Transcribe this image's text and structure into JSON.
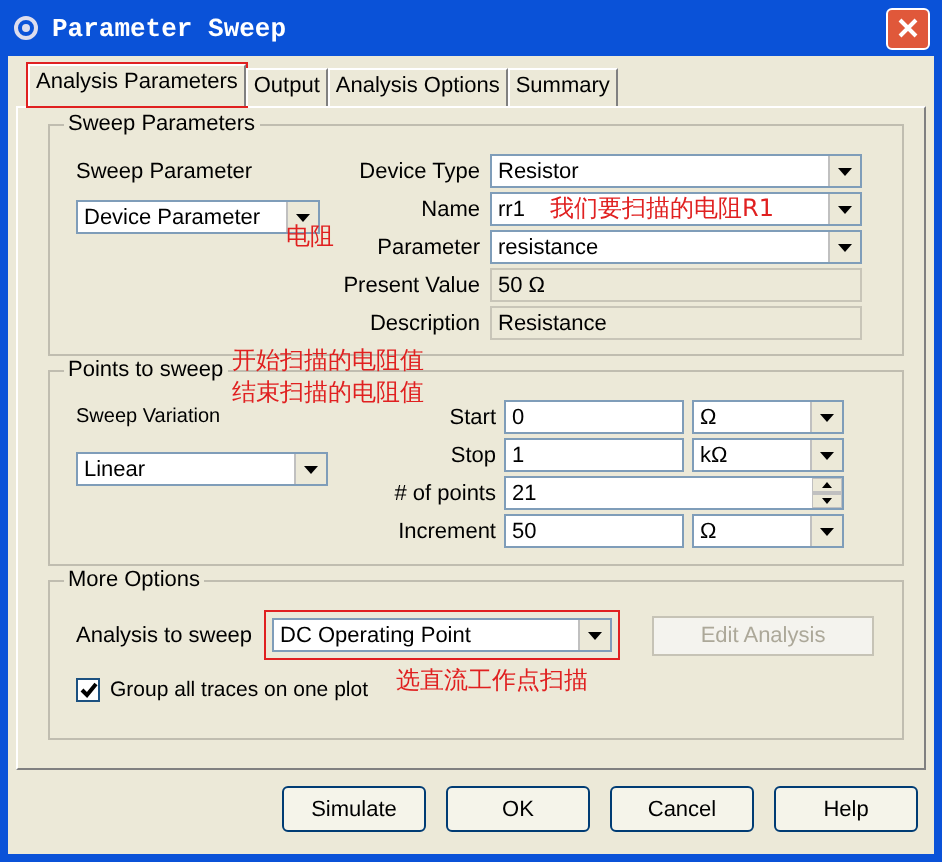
{
  "window": {
    "title": "Parameter Sweep"
  },
  "tabs": [
    {
      "label": "Analysis Parameters",
      "selected": true,
      "highlighted": true
    },
    {
      "label": "Output",
      "selected": false,
      "highlighted": false
    },
    {
      "label": "Analysis Options",
      "selected": false,
      "highlighted": false
    },
    {
      "label": "Summary",
      "selected": false,
      "highlighted": false
    }
  ],
  "sweep_parameters": {
    "title": "Sweep Parameters",
    "sweep_parameter": {
      "label": "Sweep Parameter",
      "value": "Device Parameter"
    },
    "fields": [
      {
        "label": "Device Type",
        "value": "Resistor",
        "kind": "dropdown"
      },
      {
        "label": "Name",
        "value": "rr1",
        "kind": "dropdown"
      },
      {
        "label": "Parameter",
        "value": "resistance",
        "kind": "dropdown"
      },
      {
        "label": "Present Value",
        "value": "50 Ω",
        "kind": "readonly"
      },
      {
        "label": "Description",
        "value": "Resistance",
        "kind": "readonly"
      }
    ]
  },
  "points_to_sweep": {
    "title": "Points to sweep",
    "sweep_variation": {
      "label": "Sweep Variation",
      "value": "Linear"
    },
    "fields": [
      {
        "label": "Start",
        "value": "0",
        "kind": "unit",
        "unit": "Ω"
      },
      {
        "label": "Stop",
        "value": "1",
        "kind": "unit",
        "unit": "kΩ"
      },
      {
        "label": "# of points",
        "value": "21",
        "kind": "spin"
      },
      {
        "label": "Increment",
        "value": "50",
        "kind": "unit",
        "unit": "Ω"
      }
    ]
  },
  "more_options": {
    "title": "More Options",
    "analysis_label": "Analysis to sweep",
    "analysis_value": "DC Operating Point",
    "analysis_highlighted": true,
    "edit_button": {
      "label": "Edit Analysis",
      "disabled": true
    },
    "group_traces": {
      "label": "Group all traces on one plot",
      "checked": true
    }
  },
  "buttons": [
    {
      "label": "Simulate"
    },
    {
      "label": "OK"
    },
    {
      "label": "Cancel"
    },
    {
      "label": "Help"
    }
  ],
  "annotations": [
    {
      "text": "电阻"
    },
    {
      "text": "我们要扫描的电阻R1"
    },
    {
      "text": "开始扫描的电阻值"
    },
    {
      "text": "结束扫描的电阻值"
    },
    {
      "text": "选直流工作点扫描"
    }
  ]
}
